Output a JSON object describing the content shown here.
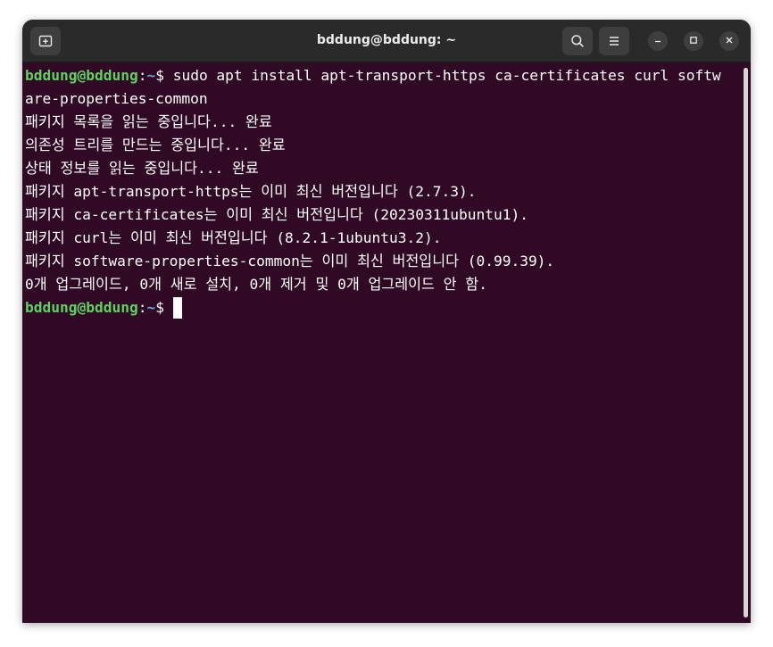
{
  "window": {
    "title": "bddung@bddung: ~"
  },
  "icons": {
    "new_tab": "new-tab-icon",
    "search": "search-icon",
    "menu": "hamburger-menu-icon",
    "minimize": "minimize-icon",
    "maximize": "maximize-icon",
    "close": "close-icon"
  },
  "colors": {
    "terminal_bg": "#300a24",
    "prompt_user": "#5fd35f",
    "prompt_path": "#6fa3e0",
    "text": "#ffffff"
  },
  "terminal": {
    "prompt1": {
      "user_host": "bddung@bddung",
      "colon": ":",
      "path": "~",
      "symbol": "$ ",
      "command": "sudo apt install apt-transport-https ca-certificates curl softw"
    },
    "wrap": "are-properties-common",
    "output": [
      "패키지 목록을 읽는 중입니다... 완료",
      "의존성 트리를 만드는 중입니다... 완료",
      "상태 정보를 읽는 중입니다... 완료",
      "패키지 apt-transport-https는 이미 최신 버전입니다 (2.7.3).",
      "패키지 ca-certificates는 이미 최신 버전입니다 (20230311ubuntu1).",
      "패키지 curl는 이미 최신 버전입니다 (8.2.1-1ubuntu3.2).",
      "패키지 software-properties-common는 이미 최신 버전입니다 (0.99.39).",
      "0개 업그레이드, 0개 새로 설치, 0개 제거 및 0개 업그레이드 안 함."
    ],
    "prompt2": {
      "user_host": "bddung@bddung",
      "colon": ":",
      "path": "~",
      "symbol": "$ "
    }
  }
}
